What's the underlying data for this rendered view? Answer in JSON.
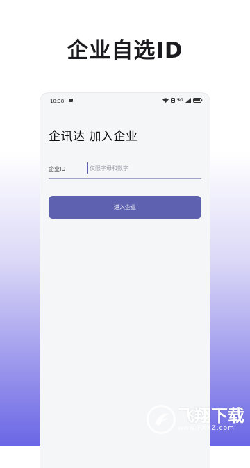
{
  "headline": "企业自选ID",
  "status_bar": {
    "time": "10:38",
    "network": "5G"
  },
  "form": {
    "title": "企讯达 加入企业",
    "id_label": "企业ID",
    "id_placeholder": "仅限字母和数字",
    "submit_label": "进入企业"
  },
  "watermark": {
    "name": "飞翔下载",
    "url": "www.FXXZ.com"
  },
  "colors": {
    "accent": "#5e61b0",
    "gradient_bottom": "#6a66e5"
  }
}
